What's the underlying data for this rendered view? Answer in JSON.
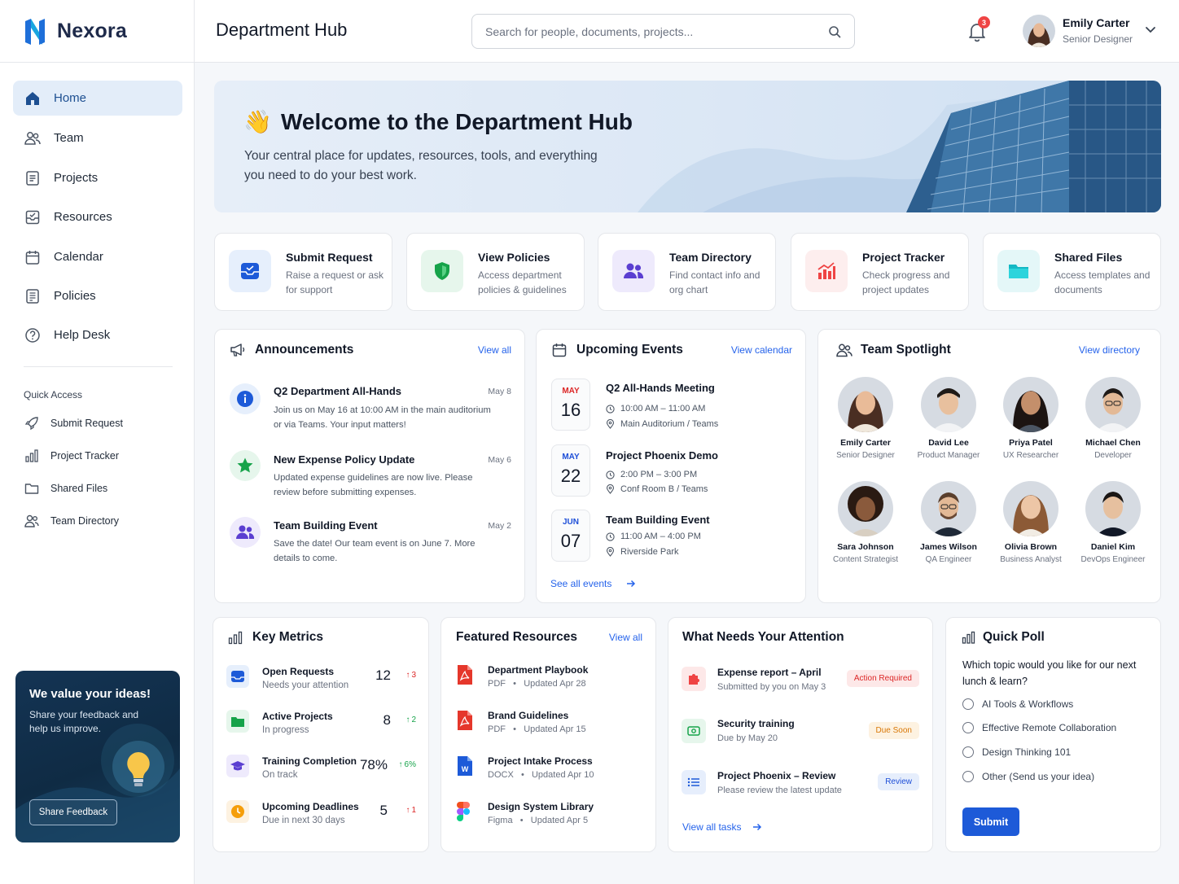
{
  "brand": {
    "name": "Nexora"
  },
  "header": {
    "title": "Department Hub",
    "search_placeholder": "Search for people, documents, projects...",
    "notifications_count": "3",
    "user": {
      "name": "Emily Carter",
      "role": "Senior Designer"
    }
  },
  "sidebar": {
    "items": [
      {
        "label": "Home",
        "icon": "home-icon",
        "active": true
      },
      {
        "label": "Team",
        "icon": "users-icon"
      },
      {
        "label": "Projects",
        "icon": "document-icon"
      },
      {
        "label": "Resources",
        "icon": "inbox-icon"
      },
      {
        "label": "Calendar",
        "icon": "calendar-icon"
      },
      {
        "label": "Policies",
        "icon": "policy-icon"
      },
      {
        "label": "Help Desk",
        "icon": "help-icon"
      }
    ],
    "quick_access_title": "Quick Access",
    "quick_access": [
      {
        "label": "Submit Request",
        "icon": "rocket-icon"
      },
      {
        "label": "Project Tracker",
        "icon": "bar-chart-icon"
      },
      {
        "label": "Shared Files",
        "icon": "folder-icon"
      },
      {
        "label": "Team Directory",
        "icon": "users-icon"
      }
    ],
    "feedback": {
      "title": "We value your ideas!",
      "text": "Share your feedback and help us improve.",
      "button": "Share Feedback"
    }
  },
  "hero": {
    "emoji": "👋",
    "title": "Welcome to the Department Hub",
    "subtitle": "Your central place for updates, resources, tools, and everything you need to do your best work."
  },
  "quick_cards": [
    {
      "title": "Submit Request",
      "desc": "Raise a request or ask for support",
      "icon": "inbox-icon",
      "color": "#1d5ad8",
      "bg": "#e6effc"
    },
    {
      "title": "View Policies",
      "desc": "Access department policies & guidelines",
      "icon": "shield-icon",
      "color": "#16a34a",
      "bg": "#e6f6ec"
    },
    {
      "title": "Team Directory",
      "desc": "Find contact info and org chart",
      "icon": "users-icon",
      "color": "#5b3fd1",
      "bg": "#eeeafc"
    },
    {
      "title": "Project Tracker",
      "desc": "Check progress and project updates",
      "icon": "bar-chart-icon",
      "color": "#ef4444",
      "bg": "#fdeeee"
    },
    {
      "title": "Shared Files",
      "desc": "Access templates and documents",
      "icon": "folder-icon",
      "color": "#14b8c4",
      "bg": "#e4f7f8"
    }
  ],
  "announcements": {
    "title": "Announcements",
    "link": "View all",
    "items": [
      {
        "title": "Q2 Department All-Hands",
        "date": "May 8",
        "text": "Join us on May 16 at 10:00 AM in the main auditorium or via Teams. Your input matters!",
        "icon": "info-icon"
      },
      {
        "title": "New Expense Policy Update",
        "date": "May 6",
        "text": "Updated expense guidelines are now live. Please review before submitting expenses.",
        "icon": "star-icon"
      },
      {
        "title": "Team Building Event",
        "date": "May 2",
        "text": "Save the date! Our team event is on June 7. More details to come.",
        "icon": "users-icon"
      }
    ]
  },
  "events": {
    "title": "Upcoming Events",
    "link": "View calendar",
    "items": [
      {
        "month": "MAY",
        "day": "16",
        "title": "Q2 All-Hands Meeting",
        "time": "10:00 AM – 11:00 AM",
        "location": "Main Auditorium / Teams"
      },
      {
        "month": "MAY",
        "day": "22",
        "title": "Project Phoenix Demo",
        "time": "2:00 PM – 3:00 PM",
        "location": "Conf Room B / Teams"
      },
      {
        "month": "JUN",
        "day": "07",
        "title": "Team Building Event",
        "time": "11:00 AM – 4:00 PM",
        "location": "Riverside Park"
      }
    ],
    "footer_link": "See all events"
  },
  "spotlight": {
    "title": "Team Spotlight",
    "link": "View directory",
    "people": [
      {
        "name": "Emily Carter",
        "role": "Senior Designer"
      },
      {
        "name": "David Lee",
        "role": "Product Manager"
      },
      {
        "name": "Priya Patel",
        "role": "UX Researcher"
      },
      {
        "name": "Michael Chen",
        "role": "Developer"
      },
      {
        "name": "Sara Johnson",
        "role": "Content Strategist"
      },
      {
        "name": "James Wilson",
        "role": "QA Engineer"
      },
      {
        "name": "Olivia Brown",
        "role": "Business Analyst"
      },
      {
        "name": "Daniel Kim",
        "role": "DevOps Engineer"
      }
    ]
  },
  "metrics": {
    "title": "Key Metrics",
    "items": [
      {
        "title": "Open Requests",
        "sub": "Needs your attention",
        "value": "12",
        "delta": "3",
        "direction": "up",
        "delta_color": "#dc2626",
        "icon": "inbox-icon"
      },
      {
        "title": "Active Projects",
        "sub": "In progress",
        "value": "8",
        "delta": "2",
        "direction": "up",
        "delta_color": "#16a34a",
        "icon": "folder-icon"
      },
      {
        "title": "Training Completion",
        "sub": "On track",
        "value": "78%",
        "delta": "6%",
        "direction": "up",
        "delta_color": "#16a34a",
        "icon": "graduation-cap-icon"
      },
      {
        "title": "Upcoming Deadlines",
        "sub": "Due in next 30 days",
        "value": "5",
        "delta": "1",
        "direction": "up",
        "delta_color": "#dc2626",
        "icon": "clock-icon"
      }
    ]
  },
  "resources": {
    "title": "Featured Resources",
    "link": "View all",
    "items": [
      {
        "title": "Department Playbook",
        "type": "PDF",
        "updated": "Updated Apr 28",
        "icon": "pdf-icon"
      },
      {
        "title": "Brand Guidelines",
        "type": "PDF",
        "updated": "Updated Apr 15",
        "icon": "pdf-icon"
      },
      {
        "title": "Project Intake Process",
        "type": "DOCX",
        "updated": "Updated Apr 10",
        "icon": "word-icon"
      },
      {
        "title": "Design System Library",
        "type": "Figma",
        "updated": "Updated Apr 5",
        "icon": "figma-icon"
      }
    ]
  },
  "attention": {
    "title": "What Needs Your Attention",
    "items": [
      {
        "title": "Expense report – April",
        "sub": "Submitted by you on May 3",
        "badge": "Action Required",
        "badge_color": "#dc2626",
        "badge_bg": "#fde8e8",
        "icon": "puzzle-icon"
      },
      {
        "title": "Security training",
        "sub": "Due by May 20",
        "badge": "Due Soon",
        "badge_color": "#d97706",
        "badge_bg": "#fdf2e1",
        "icon": "cash-icon"
      },
      {
        "title": "Project Phoenix – Review",
        "sub": "Please review the latest update",
        "badge": "Review",
        "badge_color": "#1d4ed8",
        "badge_bg": "#e6eefc",
        "icon": "list-icon"
      }
    ],
    "footer_link": "View all tasks"
  },
  "poll": {
    "title": "Quick Poll",
    "question": "Which topic would you like for our next lunch & learn?",
    "options": [
      "AI Tools & Workflows",
      "Effective Remote Collaboration",
      "Design Thinking 101",
      "Other (Send us your idea)"
    ],
    "submit": "Submit"
  }
}
